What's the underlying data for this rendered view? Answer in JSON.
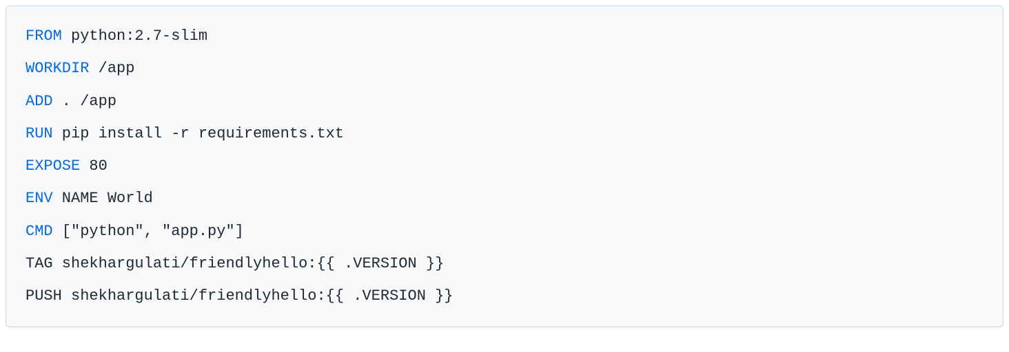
{
  "code": {
    "lines": [
      {
        "keyword": "FROM",
        "rest": " python:2.7-slim"
      },
      {
        "keyword": "WORKDIR",
        "rest": " /app"
      },
      {
        "keyword": "ADD",
        "rest": " . /app"
      },
      {
        "keyword": "RUN",
        "rest": " pip install -r requirements.txt"
      },
      {
        "keyword": "EXPOSE",
        "rest": " 80"
      },
      {
        "keyword": "ENV",
        "rest": " NAME World"
      },
      {
        "keyword": "CMD",
        "rest": " [\"python\", \"app.py\"]"
      },
      {
        "keyword": "",
        "rest": "TAG shekhargulati/friendlyhello:{{ .VERSION }}"
      },
      {
        "keyword": "",
        "rest": "PUSH shekhargulati/friendlyhello:{{ .VERSION }}"
      }
    ]
  }
}
